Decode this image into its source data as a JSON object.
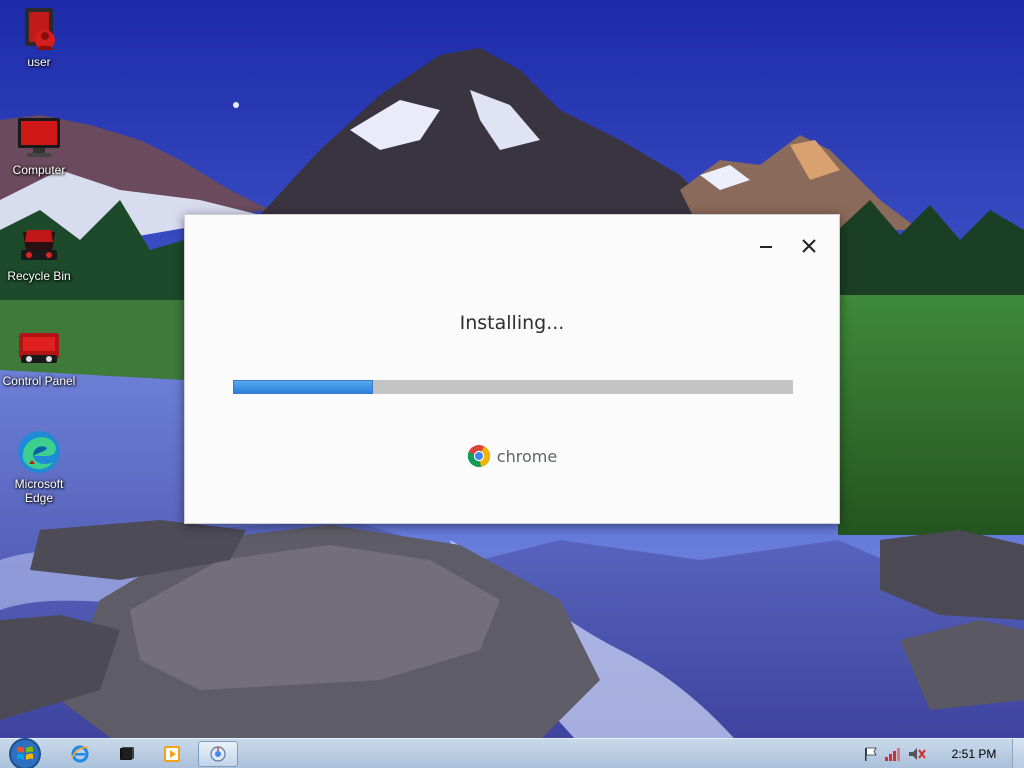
{
  "desktop": {
    "icons": [
      {
        "label": "user",
        "icon": "user-folder-icon"
      },
      {
        "label": "Computer",
        "icon": "computer-icon"
      },
      {
        "label": "Recycle Bin",
        "icon": "recycle-bin-icon"
      },
      {
        "label": "Control Panel",
        "icon": "control-panel-icon"
      },
      {
        "label": "Microsoft Edge",
        "icon": "edge-icon"
      }
    ]
  },
  "installer": {
    "status": "Installing...",
    "progress": 0.25,
    "brand": "chrome",
    "controls": {
      "minimize": "minimize-icon",
      "close": "close-icon"
    }
  },
  "taskbar": {
    "pinned": [
      {
        "name": "internet-explorer",
        "icon": "ie-icon"
      },
      {
        "name": "terminal",
        "icon": "terminal-icon"
      },
      {
        "name": "media-player",
        "icon": "media-player-icon"
      },
      {
        "name": "chrome-installer",
        "icon": "installer-icon",
        "active": true
      }
    ],
    "tray": [
      "action-center-flag-icon",
      "network-signal-icon",
      "volume-muted-icon"
    ],
    "clock": "2:51 PM"
  },
  "colors": {
    "progress_fill": "#2a80dc",
    "progress_track": "#c4c4c4",
    "taskbar": "#b9cde3"
  }
}
